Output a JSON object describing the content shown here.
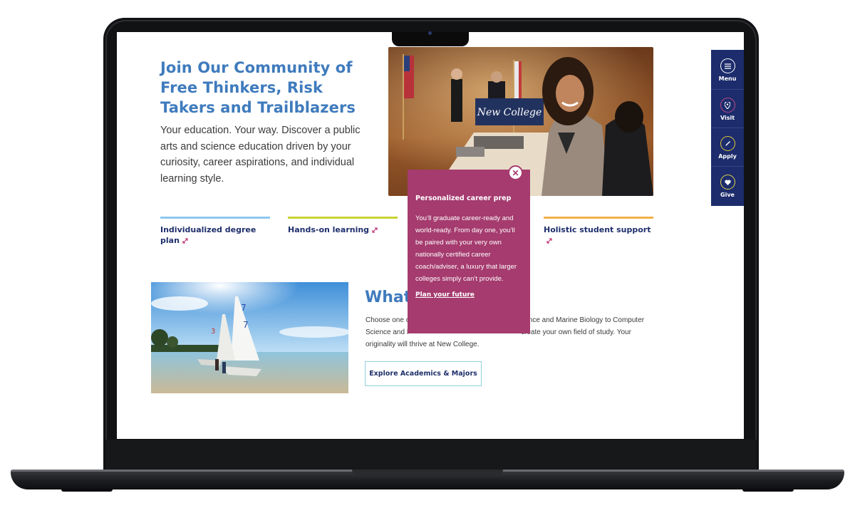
{
  "hero": {
    "title": "Join Our Community of Free Thinkers, Risk Takers and Trailblazers",
    "description": "Your education. Your way. Discover a public arts and science education driven by your curiosity, career aspirations, and individual learning style.",
    "photo_signage": "New College"
  },
  "features": [
    {
      "label": "Individualized degree plan",
      "color": "#8ec8f0",
      "icon": "expand-arrow-icon"
    },
    {
      "label": "Hands-on learning",
      "color": "#c8d432",
      "icon": "expand-arrow-icon"
    },
    {
      "label": "Holistic student support",
      "color": "#f0b24a",
      "icon": "expand-arrow-icon"
    }
  ],
  "popup": {
    "title": "Personalized career prep",
    "body": "You’ll graduate career-ready and world-ready. From day one, you’ll be paired with your very own nationally certified career coach/adviser, a luxury that larger colleges simply can’t provide.",
    "link": "Plan your future",
    "close_icon": "close-icon",
    "color": "#a53b6e"
  },
  "section": {
    "title_visible": "What",
    "title_end": "?",
    "body_line1_start": "Choose one o",
    "body_line1_end": "ience and Marine Biology to Computer",
    "body_line2_start": "Science and P",
    "body_line2_end": "create your own field of study. Your",
    "body_line3": "originality will thrive at New College.",
    "button": "Explore Academics & Majors"
  },
  "sidenav": {
    "color": "#1c2c6c",
    "items": [
      {
        "label": "Menu",
        "icon": "menu-icon",
        "ring": "#ffffff"
      },
      {
        "label": "Visit",
        "icon": "map-pin-icon",
        "ring": "#c04a86"
      },
      {
        "label": "Apply",
        "icon": "pencil-icon",
        "ring": "#e0c53a"
      },
      {
        "label": "Give",
        "icon": "heart-icon",
        "ring": "#e0d44a"
      }
    ]
  }
}
